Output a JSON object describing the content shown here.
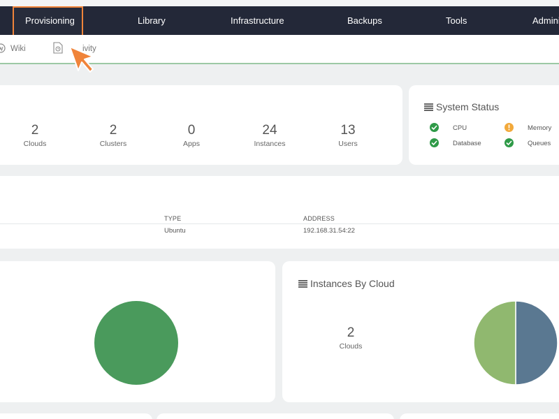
{
  "nav": {
    "items": [
      {
        "label": "Provisioning",
        "highlighted": true
      },
      {
        "label": "Library"
      },
      {
        "label": "Infrastructure"
      },
      {
        "label": "Backups"
      },
      {
        "label": "Tools"
      },
      {
        "label": "Admini"
      }
    ]
  },
  "subnav": {
    "items": [
      {
        "label": "Wiki",
        "icon": "wiki-icon"
      },
      {
        "label": "ivity",
        "icon": "activity-icon"
      }
    ]
  },
  "summary": {
    "stats": [
      {
        "value": "2",
        "label": "Clouds"
      },
      {
        "value": "2",
        "label": "Clusters"
      },
      {
        "value": "0",
        "label": "Apps"
      },
      {
        "value": "24",
        "label": "Instances"
      },
      {
        "value": "13",
        "label": "Users"
      }
    ]
  },
  "system_status": {
    "title": "System Status",
    "items": [
      {
        "label": "CPU",
        "status": "ok"
      },
      {
        "label": "Memory",
        "status": "warn"
      },
      {
        "label": "Database",
        "status": "ok"
      },
      {
        "label": "Queues",
        "status": "ok"
      }
    ]
  },
  "table": {
    "columns": [
      "TYPE",
      "ADDRESS"
    ],
    "rows": [
      {
        "type": "Ubuntu",
        "address": "192.168.31.54:22"
      }
    ]
  },
  "instances_by_cloud": {
    "title": "Instances By Cloud",
    "value": "2",
    "label": "Clouds"
  },
  "colors": {
    "accent": "#f0843a",
    "navbar": "#232838",
    "ok": "#2f9a48",
    "warn": "#f2a93b",
    "pie_green": "#4a9a5c",
    "pie_light_green": "#90b86f",
    "pie_blue": "#5a7891"
  },
  "chart_data": [
    {
      "type": "pie",
      "values": [
        1
      ],
      "colors": [
        "#4a9a5c"
      ]
    },
    {
      "type": "pie",
      "values": [
        1,
        1
      ],
      "colors": [
        "#90b86f",
        "#5a7891"
      ]
    }
  ]
}
